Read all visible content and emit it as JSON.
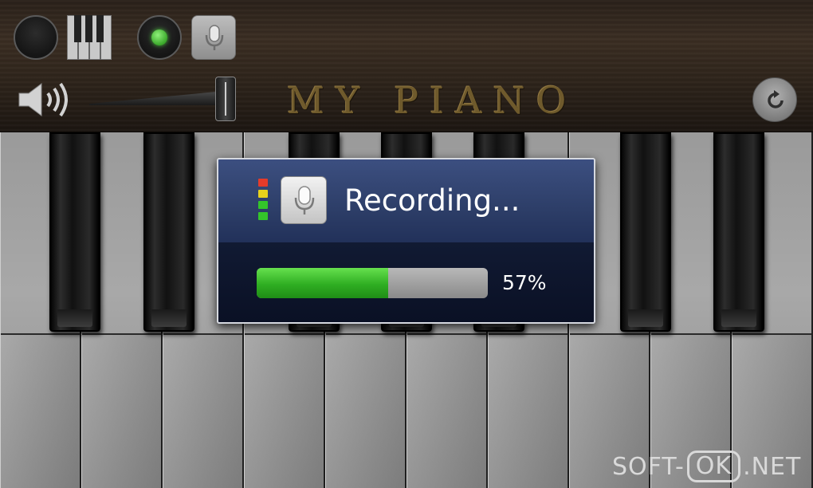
{
  "app": {
    "title": "MY PIANO"
  },
  "toolbar": {
    "stop_icon": "stop-icon",
    "keys_icon": "piano-keys-icon",
    "record_icon": "record-icon",
    "mic_icon": "microphone-icon",
    "reset_icon": "refresh-icon"
  },
  "volume": {
    "icon": "speaker-icon",
    "level": 1.0
  },
  "keyboard": {
    "white_keys": 10,
    "black_keys": 7
  },
  "dialog": {
    "title": "Recording...",
    "progress_percent": 57,
    "progress_text": "57%",
    "level_colors": [
      "#e53b2a",
      "#e8d21c",
      "#34c52a",
      "#34c52a"
    ],
    "accent": "#2fae22"
  },
  "watermark": {
    "prefix": "SOFT-",
    "boxed": "OK",
    "suffix": ".NET"
  }
}
